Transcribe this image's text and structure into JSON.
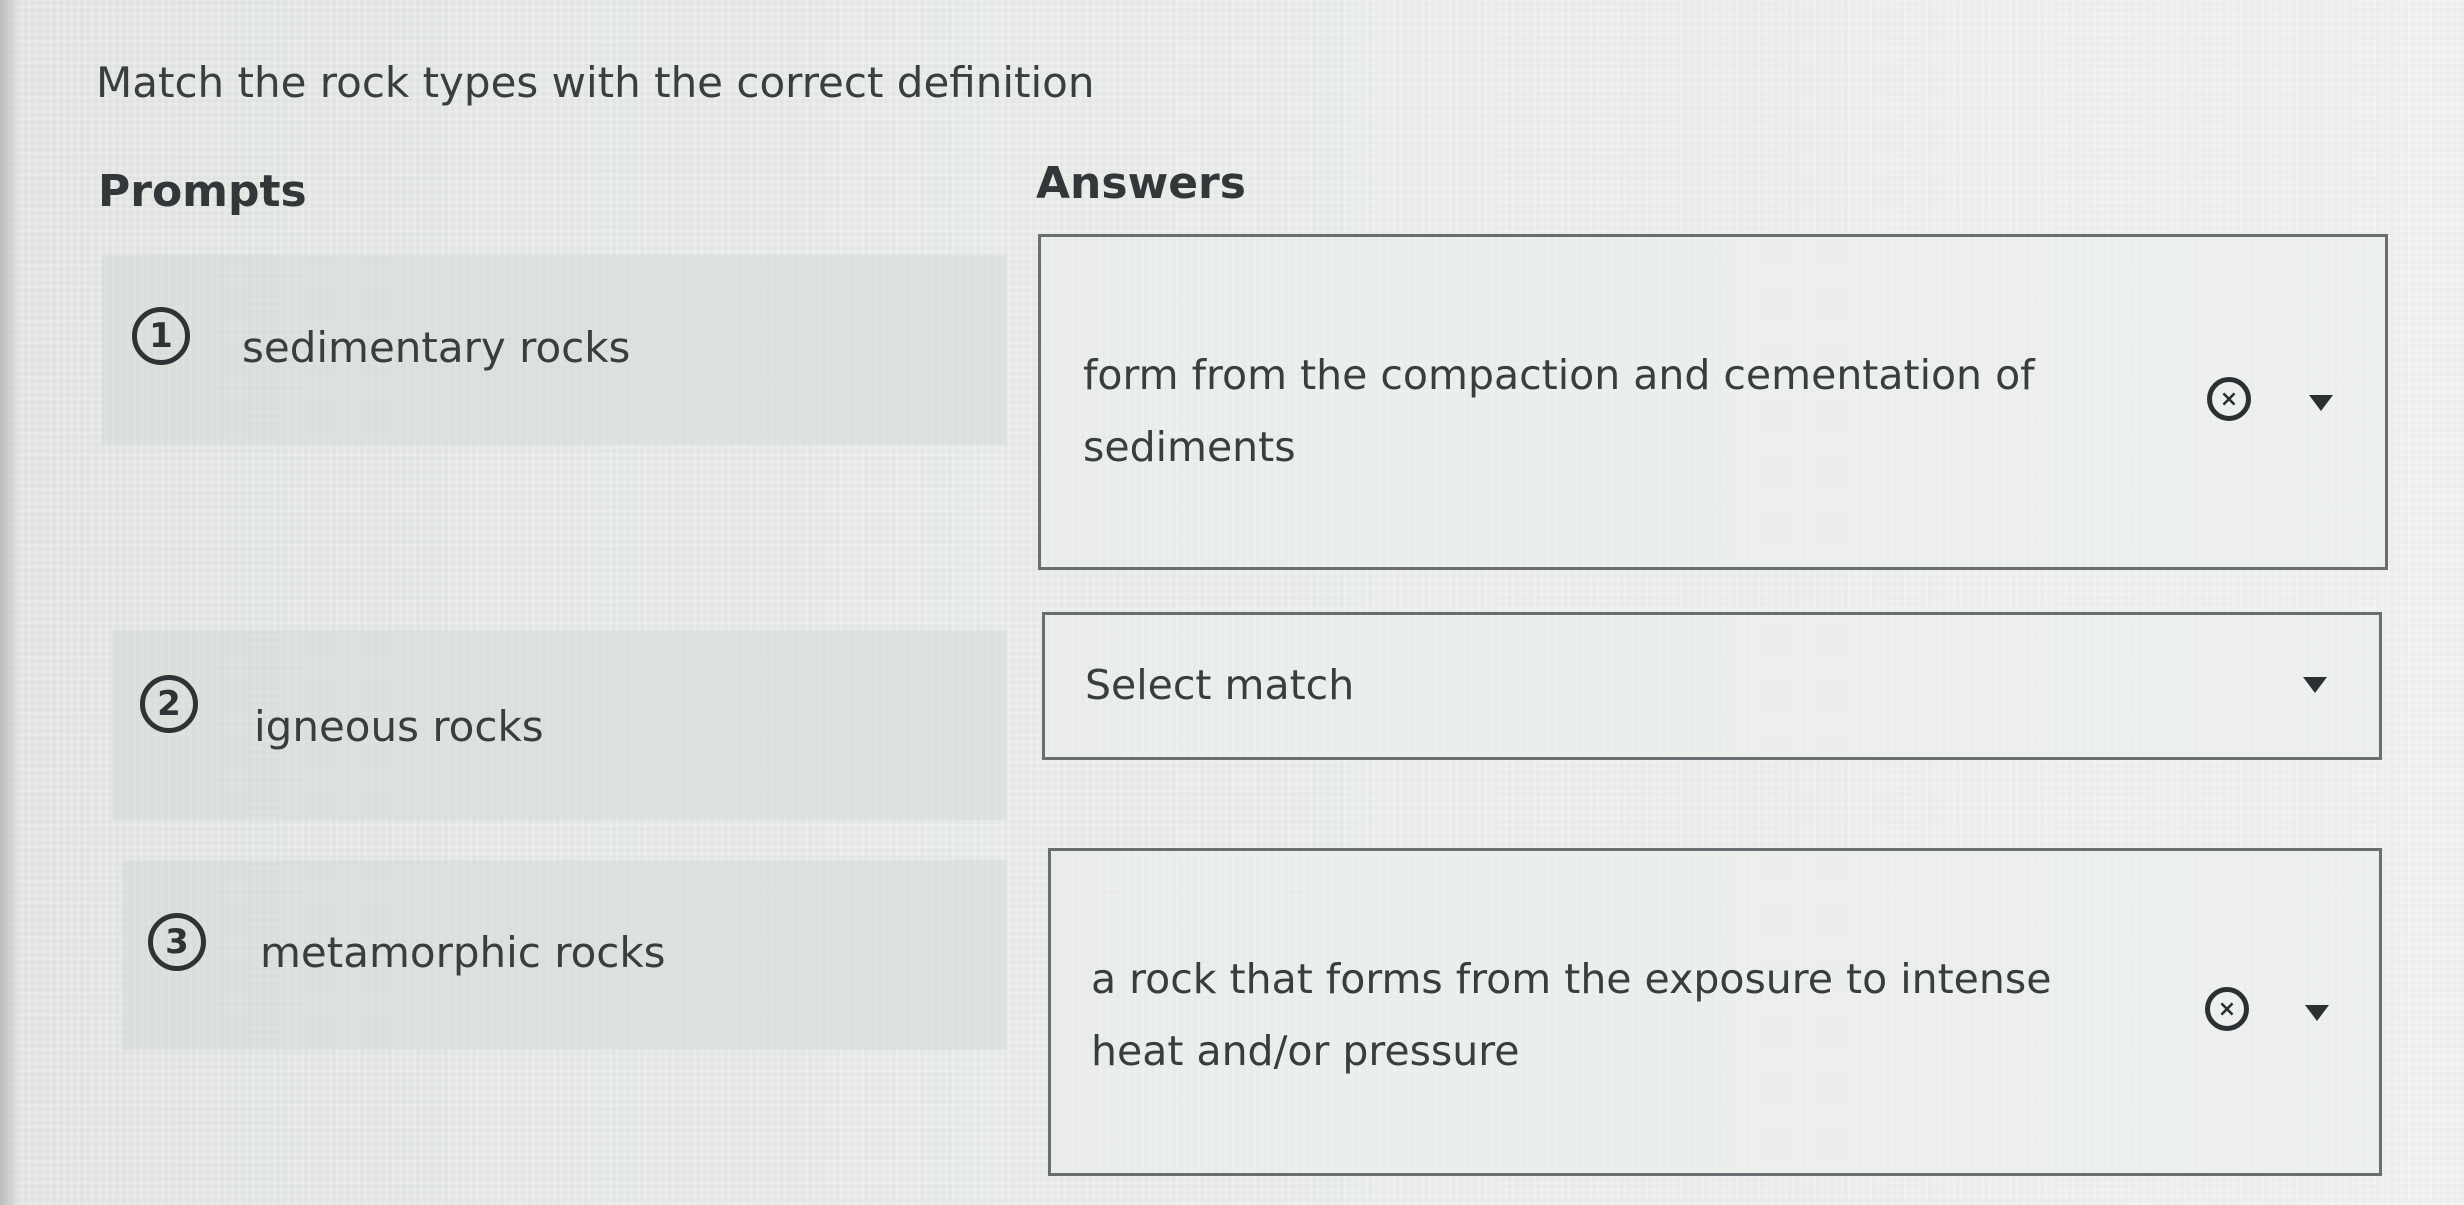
{
  "question": "Match the rock types with the correct definition",
  "headers": {
    "prompts": "Prompts",
    "answers": "Answers"
  },
  "prompts": [
    {
      "number": "1",
      "label": "sedimentary rocks"
    },
    {
      "number": "2",
      "label": "igneous rocks"
    },
    {
      "number": "3",
      "label": "metamorphic rocks"
    }
  ],
  "answers": [
    {
      "text": "form from the compaction and cementation of sediments",
      "clear_icon": "×",
      "dropdown_icon": "caret-down"
    },
    {
      "text": "Select match",
      "dropdown_icon": "caret-down"
    },
    {
      "text": "a rock that forms from the exposure to intense heat and/or pressure",
      "clear_icon": "×",
      "dropdown_icon": "caret-down"
    }
  ]
}
